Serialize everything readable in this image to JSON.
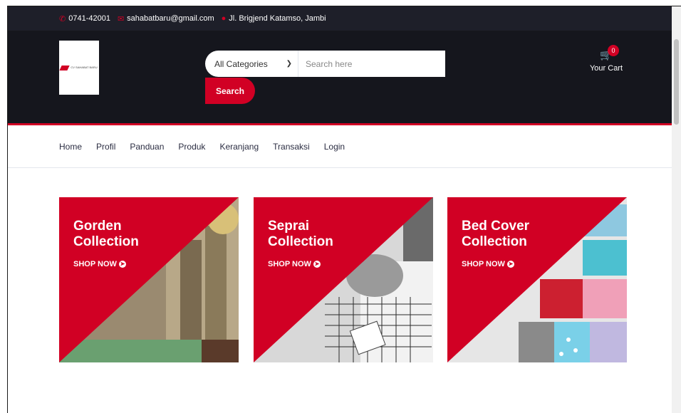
{
  "topbar": {
    "phone": "0741-42001",
    "email": "sahabatbaru@gmail.com",
    "address": "Jl. Brigjend Katamso, Jambi"
  },
  "logo": {
    "text": "CV SAHABAT BARU"
  },
  "search": {
    "category": "All Categories",
    "placeholder": "Search here",
    "button": "Search"
  },
  "cart": {
    "qty": "0",
    "label": "Your Cart"
  },
  "nav": {
    "items": [
      "Home",
      "Profil",
      "Panduan",
      "Produk",
      "Keranjang",
      "Transaksi",
      "Login"
    ]
  },
  "collections": [
    {
      "line1": "Gorden",
      "line2": "Collection",
      "cta": "SHOP NOW"
    },
    {
      "line1": "Seprai",
      "line2": "Collection",
      "cta": "SHOP NOW"
    },
    {
      "line1": "Bed Cover",
      "line2": "Collection",
      "cta": "SHOP NOW"
    }
  ],
  "colors": {
    "accent": "#D10024",
    "topbar": "#1E1F29",
    "header": "#15161D"
  }
}
